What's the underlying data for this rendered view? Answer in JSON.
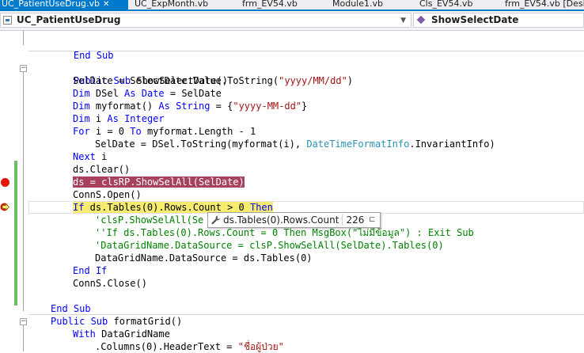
{
  "tabs": [
    {
      "label": "UC_PatientUseDrug.vb",
      "active": true,
      "closable": true
    },
    {
      "label": "UC_ExpMonth.vb",
      "active": false
    },
    {
      "label": "frm_EV54.vb",
      "active": false
    },
    {
      "label": "Module1.vb",
      "active": false
    },
    {
      "label": "Cls_EV54.vb",
      "active": false
    },
    {
      "label": "frm_EV54.vb [Desig",
      "active": false
    }
  ],
  "navbar": {
    "class_combo": "UC_PatientUseDrug",
    "member_combo": "ShowSelectDate"
  },
  "code_lines": [
    {
      "code": "",
      "indent": 0
    },
    {
      "code": "End Sub",
      "indent": 1
    },
    {
      "code": "",
      "indent": 0
    },
    {
      "code": "Public Sub ShowSelectDate()",
      "indent": 1
    },
    {
      "code": "SelDate = SelectDate.Value.ToString(\"yyyy/MM/dd\")",
      "indent": 2
    },
    {
      "code": "Dim DSel As Date = SelDate",
      "indent": 2
    },
    {
      "code": "Dim myformat() As String = {\"yyyy-MM-dd\"}",
      "indent": 2
    },
    {
      "code": "Dim i As Integer",
      "indent": 2
    },
    {
      "code": "For i = 0 To myformat.Length - 1",
      "indent": 2
    },
    {
      "code": "SelDate = DSel.ToString(myformat(i), DateTimeFormatInfo.InvariantInfo)",
      "indent": 3
    },
    {
      "code": "Next i",
      "indent": 2
    },
    {
      "code": "ds.Clear()",
      "indent": 2
    },
    {
      "code": "ds = clsRP.ShowSelAll(SelDate)",
      "indent": 2
    },
    {
      "code": "ConnS.Open()",
      "indent": 2
    },
    {
      "code": "If ds.Tables(0).Rows.Count > 0 Then",
      "indent": 2
    },
    {
      "code": "'clsP.ShowSelAll(Se",
      "indent": 3
    },
    {
      "code": "''If ds.Tables(0).Rows.Count = 0 Then MsgBox(\"ไม่มีข้อมูล\") : Exit Sub",
      "indent": 3
    },
    {
      "code": "'DataGridName.DataSource = clsP.ShowSelAll(SelDate).Tables(0)",
      "indent": 3
    },
    {
      "code": "DataGridName.DataSource = ds.Tables(0)",
      "indent": 3
    },
    {
      "code": "End If",
      "indent": 2
    },
    {
      "code": "ConnS.Close()",
      "indent": 2
    },
    {
      "code": "",
      "indent": 0
    },
    {
      "code": "End Sub",
      "indent": 1
    },
    {
      "code": "Public Sub formatGrid()",
      "indent": 1
    },
    {
      "code": "With DataGridName",
      "indent": 2
    },
    {
      "code": ".Columns(0).HeaderText = \"ชื่อผู้ป่วย\"",
      "indent": 3
    }
  ],
  "datatip": {
    "expression": "ds.Tables(0).Rows.Count",
    "value": "226"
  },
  "colors": {
    "keyword": "#0000FF",
    "string": "#A31515",
    "type": "#2B91AF",
    "comment": "#008000",
    "breakpoint_highlight": "#A7415D",
    "current_statement": "#F6EC70",
    "breakpoint": "#E51400",
    "tab_active": "#007ACC"
  },
  "icons": {
    "breakpoint": "breakpoint-icon",
    "current_statement": "current-statement-arrow-icon",
    "datatip": "wrench-icon",
    "pin": "pin-icon"
  }
}
